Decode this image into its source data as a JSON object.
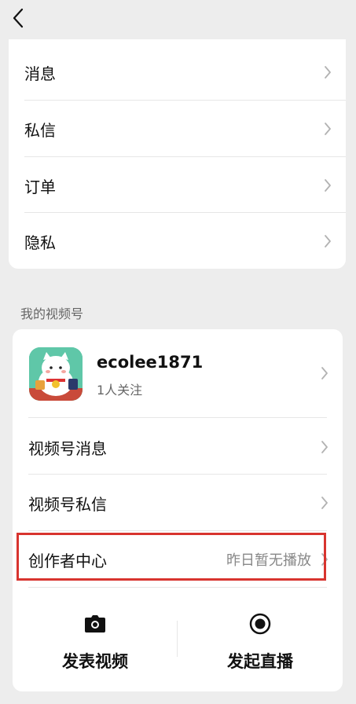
{
  "header": {
    "back_icon": "back-chevron-icon"
  },
  "settings_list": [
    {
      "label": "消息"
    },
    {
      "label": "私信"
    },
    {
      "label": "订单"
    },
    {
      "label": "隐私"
    }
  ],
  "channel_section": {
    "title": "我的视频号",
    "profile": {
      "username": "ecolee1871",
      "followers": "1人关注",
      "avatar_icon": "lucky-cat-avatar"
    },
    "items": [
      {
        "label": "视频号消息",
        "value": ""
      },
      {
        "label": "视频号私信",
        "value": ""
      },
      {
        "label": "创作者中心",
        "value": "昨日暂无播放"
      }
    ],
    "actions": [
      {
        "label": "发表视频",
        "icon": "camera-icon"
      },
      {
        "label": "发起直播",
        "icon": "live-record-icon"
      }
    ]
  },
  "colors": {
    "highlight_border": "#d8342f",
    "background": "#ededed"
  }
}
